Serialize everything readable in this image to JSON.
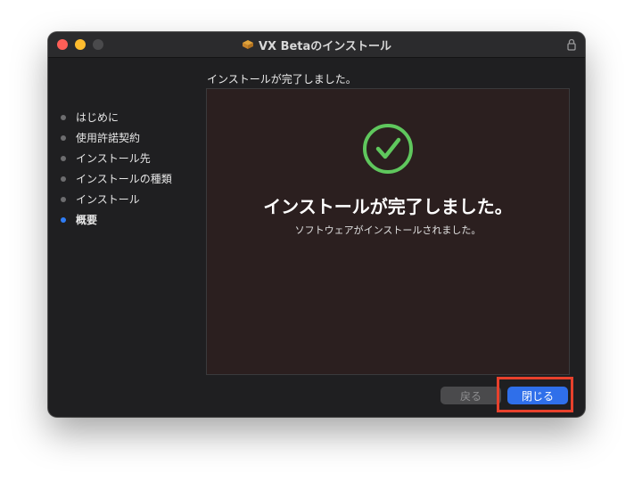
{
  "window": {
    "title": "VX Betaのインストール"
  },
  "sidebar": {
    "steps": [
      {
        "label": "はじめに",
        "active": false
      },
      {
        "label": "使用許諾契約",
        "active": false
      },
      {
        "label": "インストール先",
        "active": false
      },
      {
        "label": "インストールの種類",
        "active": false
      },
      {
        "label": "インストール",
        "active": false
      },
      {
        "label": "概要",
        "active": true
      }
    ]
  },
  "main": {
    "header": "インストールが完了しました。",
    "big_title": "インストールが完了しました。",
    "subtitle": "ソフトウェアがインストールされました。"
  },
  "buttons": {
    "back_label": "戻る",
    "close_label": "閉じる"
  },
  "colors": {
    "accent": "#2f6fea",
    "success": "#5fc75d",
    "highlight": "#e8412c"
  }
}
